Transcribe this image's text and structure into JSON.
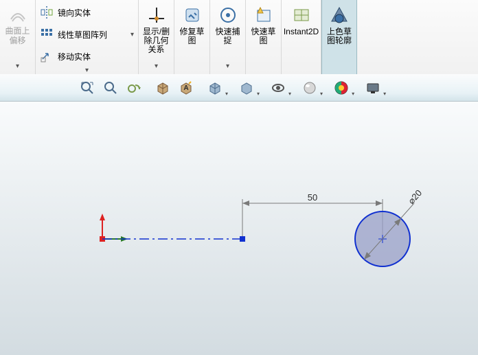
{
  "left_disabled": {
    "label": "曲面上\n偏移"
  },
  "list": {
    "mirror": {
      "label": "镜向实体"
    },
    "linearPattern": {
      "label": "线性草图阵列"
    },
    "moveEntities": {
      "label": "移动实体"
    }
  },
  "big": {
    "displayDelete": {
      "label": "显示/删\n除几何\n关系"
    },
    "repairSketch": {
      "label": "修复草\n图"
    },
    "quickSnap": {
      "label": "快速捕\n捉"
    },
    "rapidSketch": {
      "label": "快速草\n图"
    },
    "instant2d": {
      "label": "Instant2D"
    },
    "shadeContour": {
      "label": "上色草\n图轮廓"
    }
  },
  "hud": {
    "zoomFit": "zoom-fit",
    "zoomArea": "zoom-area",
    "prevView": "prev-view",
    "sectionView": "section-view",
    "dynAnnot": "dynamic-annotation",
    "viewOrient": "view-orientation",
    "dispStyle": "display-style",
    "hideShow": "hide-show",
    "editAppear": "edit-appearance",
    "applyScene": "apply-scene",
    "viewSettings": "view-settings"
  },
  "sketch": {
    "dimension_horizontal": "50",
    "dimension_diameter": "20"
  }
}
